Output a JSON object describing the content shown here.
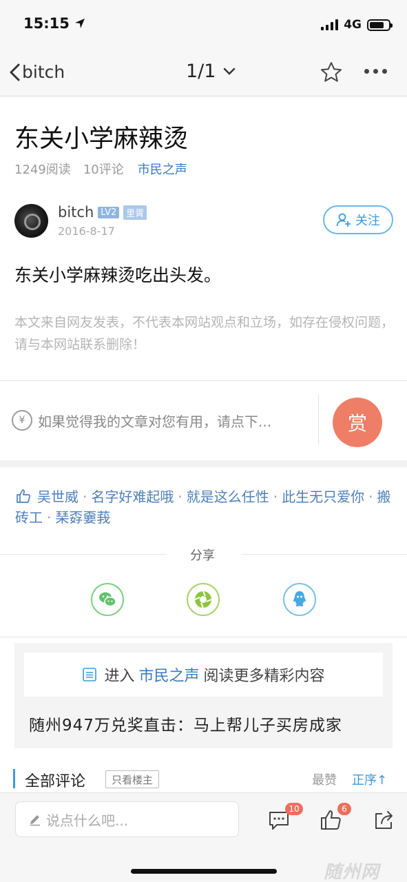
{
  "status_bar": {
    "time": "15:15",
    "network": "4G"
  },
  "nav": {
    "back_label": "bitch",
    "page_indicator": "1/1"
  },
  "article": {
    "title": "东关小学麻辣烫",
    "reads": "1249阅读",
    "comments": "10评论",
    "forum": "市民之声",
    "author": {
      "name": "bitch",
      "level": "LV2",
      "rank": "里胥",
      "date": "2016-8-17"
    },
    "follow_label": "关注",
    "body": "东关小学麻辣烫吃出头发。",
    "disclaimer": "本文来自网友发表，不代表本网站观点和立场，如存在侵权问题，请与本网站联系删除！"
  },
  "reward": {
    "prompt": "如果觉得我的文章对您有用，请点下...",
    "button_label": "赏",
    "currency_symbol": "¥"
  },
  "likes": {
    "users": [
      "吴世威",
      "名字好难起哦",
      "就是这么任性",
      "此生无只爱你",
      "搬砖工",
      "琹孬嫑莪"
    ]
  },
  "share": {
    "label": "分享",
    "icons": [
      "wechat-icon",
      "moments-icon",
      "qq-icon"
    ]
  },
  "promo": {
    "enter_prefix": "进入",
    "forum": "市民之声",
    "enter_suffix": "阅读更多精彩内容",
    "headline": "随州947万兑奖直击：马上帮儿子买房成家"
  },
  "comments": {
    "title": "全部评论",
    "host_only_label": "只看楼主",
    "sort_hot": "最赞",
    "sort_order": "正序↑"
  },
  "bottom_bar": {
    "input_placeholder": "说点什么吧...",
    "comment_count": "10",
    "like_count": "6",
    "watermark": "随州网"
  },
  "colors": {
    "accent_blue": "#3a9ad9",
    "link_blue": "#3a7bbf",
    "reward_orange": "#ee7e66",
    "badge_red": "#ef6e5e"
  }
}
